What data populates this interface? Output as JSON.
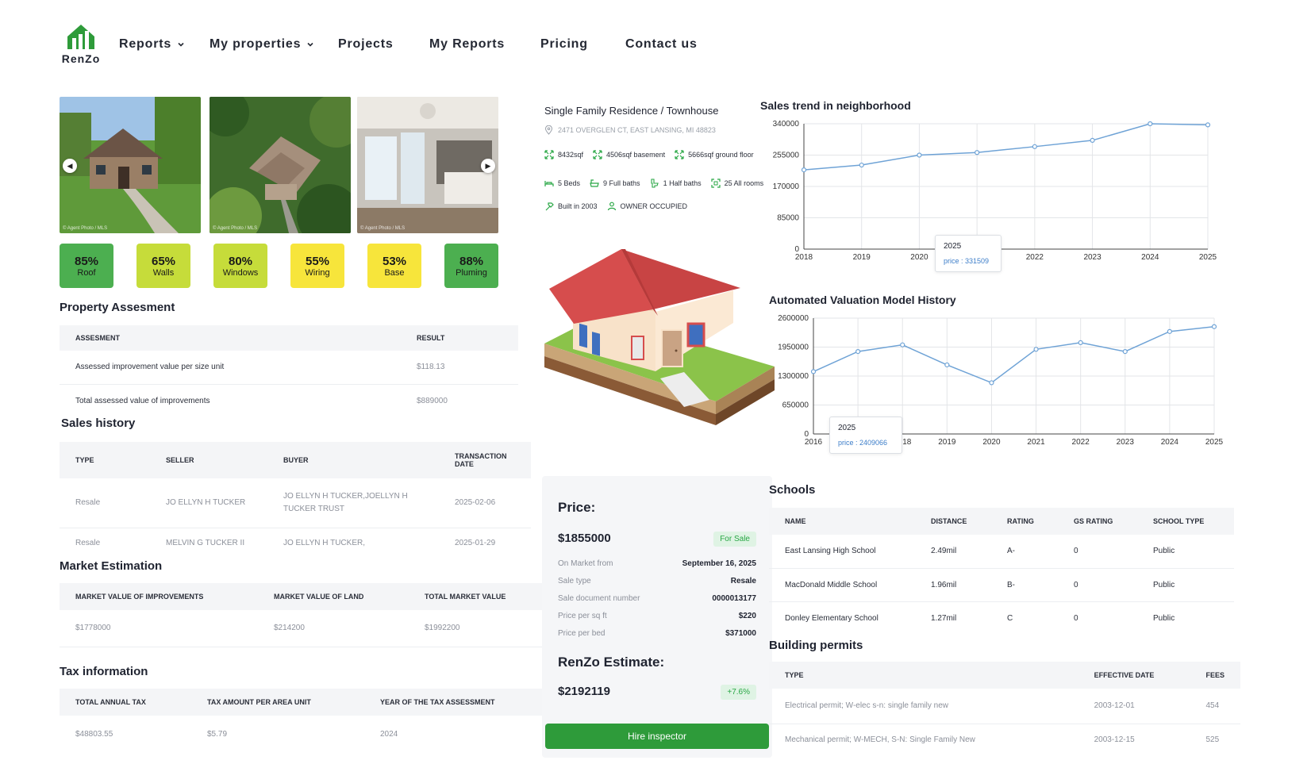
{
  "nav": {
    "logo_text": "RenZo",
    "items": [
      {
        "label": "Reports",
        "dropdown": true
      },
      {
        "label": "My properties",
        "dropdown": true
      },
      {
        "label": "Projects",
        "dropdown": false
      },
      {
        "label": "My Reports",
        "dropdown": false
      },
      {
        "label": "Pricing",
        "dropdown": false
      },
      {
        "label": "Contact us",
        "dropdown": false
      }
    ]
  },
  "gallery": {
    "captions": [
      "© Agent Photo / MLS",
      "© Agent Photo / MLS",
      "© Agent Photo / MLS"
    ]
  },
  "conditions": [
    {
      "pct": "85%",
      "label": "Roof",
      "color": "#4caf50"
    },
    {
      "pct": "65%",
      "label": "Walls",
      "color": "#c6dc3a"
    },
    {
      "pct": "80%",
      "label": "Windows",
      "color": "#c6dc3a"
    },
    {
      "pct": "55%",
      "label": "Wiring",
      "color": "#f7e53b"
    },
    {
      "pct": "53%",
      "label": "Base",
      "color": "#f7e53b"
    },
    {
      "pct": "88%",
      "label": "Pluming",
      "color": "#4caf50"
    }
  ],
  "assessment": {
    "title": "Property Assesment",
    "headers": [
      "ASSESMENT",
      "RESULT"
    ],
    "rows": [
      [
        "Assessed improvement value per size unit",
        "$118.13"
      ],
      [
        "Total assessed value of improvements",
        "$889000"
      ]
    ]
  },
  "sales_history": {
    "title": "Sales history",
    "headers": [
      "TYPE",
      "SELLER",
      "BUYER",
      "TRANSACTION DATE"
    ],
    "rows": [
      [
        "Resale",
        "JO ELLYN H TUCKER",
        "JO ELLYN H TUCKER,JOELLYN H TUCKER TRUST",
        "2025-02-06"
      ],
      [
        "Resale",
        "MELVIN G TUCKER II",
        "JO ELLYN H TUCKER,",
        "2025-01-29"
      ]
    ]
  },
  "market": {
    "title": "Market Estimation",
    "headers": [
      "MARKET VALUE OF IMPROVEMENTS",
      "MARKET VALUE OF LAND",
      "TOTAL MARKET VALUE"
    ],
    "rows": [
      [
        "$1778000",
        "$214200",
        "$1992200"
      ]
    ]
  },
  "tax": {
    "title": "Tax information",
    "headers": [
      "TOTAL ANNUAL TAX",
      "TAX AMOUNT PER AREA UNIT",
      "YEAR OF THE TAX ASSESSMENT"
    ],
    "rows": [
      [
        "$48803.55",
        "$5.79",
        "2024"
      ]
    ]
  },
  "property": {
    "title": "Single Family Residence / Townhouse",
    "address": "2471 OVERGLEN CT, EAST LANSING, MI 48823",
    "areas": [
      "8432sqf",
      "4506sqf basement",
      "5666sqf ground floor"
    ],
    "rooms": [
      "5 Beds",
      "9 Full baths",
      "1 Half baths",
      "25 All rooms"
    ],
    "built": "Built in 2003",
    "occupancy": "OWNER OCCUPIED"
  },
  "price_card": {
    "price_heading": "Price:",
    "price": "$1855000",
    "status": "For Sale",
    "details": [
      {
        "k": "On Market from",
        "v": "September 16, 2025"
      },
      {
        "k": "Sale type",
        "v": "Resale"
      },
      {
        "k": "Sale document number",
        "v": "0000013177"
      },
      {
        "k": "Price per sq ft",
        "v": "$220"
      },
      {
        "k": "Price per bed",
        "v": "$371000"
      }
    ],
    "estimate_heading": "RenZo Estimate:",
    "estimate": "$2192119",
    "estimate_change": "+7.6%",
    "hire_label": "Hire inspector"
  },
  "chart_data": [
    {
      "type": "line",
      "title": "Sales trend in neighborhood",
      "x": [
        "2018",
        "2019",
        "2020",
        "2021",
        "2022",
        "2023",
        "2024",
        "2025"
      ],
      "series": [
        {
          "values": [
            215000,
            228000,
            255000,
            262000,
            278000,
            295000,
            340000,
            337000
          ]
        }
      ],
      "yticks": [
        0,
        85000,
        170000,
        255000,
        340000
      ],
      "ylim": [
        0,
        340000
      ],
      "grid": true,
      "tooltip": {
        "year": "2025",
        "text": "price : 331509"
      },
      "color": "#6fa3d6"
    },
    {
      "type": "line",
      "title": "Automated Valuation Model History",
      "x": [
        "2016",
        "2017",
        "2018",
        "2019",
        "2020",
        "2021",
        "2022",
        "2023",
        "2024",
        "2025"
      ],
      "series": [
        {
          "values": [
            1400000,
            1850000,
            2000000,
            1550000,
            1150000,
            1900000,
            2050000,
            1850000,
            2300000,
            2409066
          ]
        }
      ],
      "yticks": [
        0,
        650000,
        1300000,
        1950000,
        2600000
      ],
      "ylim": [
        0,
        2600000
      ],
      "grid": true,
      "tooltip": {
        "year": "2025",
        "text": "price : 2409066"
      },
      "color": "#6fa3d6"
    }
  ],
  "schools": {
    "title": "Schools",
    "headers": [
      "NAME",
      "DISTANCE",
      "RATING",
      "GS RATING",
      "SCHOOL TYPE"
    ],
    "rows": [
      [
        "East Lansing High School",
        "2.49mil",
        "A-",
        "0",
        "Public"
      ],
      [
        "MacDonald Middle School",
        "1.96mil",
        "B-",
        "0",
        "Public"
      ],
      [
        "Donley Elementary School",
        "1.27mil",
        "C",
        "0",
        "Public"
      ]
    ]
  },
  "permits": {
    "title": "Building permits",
    "headers": [
      "TYPE",
      "EFFECTIVE DATE",
      "FEES"
    ],
    "rows": [
      [
        "Electrical permit; W-elec s-n: single family new",
        "2003-12-01",
        "454"
      ],
      [
        "Mechanical permit; W-MECH, S-N: Single Family New",
        "2003-12-15",
        "525"
      ]
    ]
  }
}
